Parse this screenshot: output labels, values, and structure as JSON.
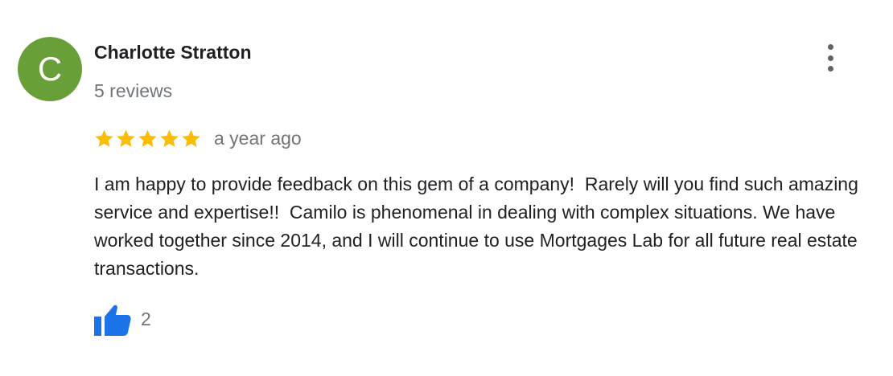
{
  "review": {
    "avatar_letter": "C",
    "avatar_color": "#689f38",
    "author_name": "Charlotte Stratton",
    "review_count": "5 reviews",
    "rating": 5,
    "rating_max": 5,
    "star_color": "#fbbc04",
    "time_ago": "a year ago",
    "text": "I am happy to provide feedback on this gem of a company!  Rarely will you find such amazing service and expertise!!  Camilo is phenomenal in dealing with complex situations. We have worked together since 2014, and I will continue to use Mortgages Lab for all future real estate transactions.",
    "like_icon": "thumbs-up-icon",
    "like_icon_color": "#1a73e8",
    "like_count": "2",
    "more_icon": "more-vert-icon"
  }
}
